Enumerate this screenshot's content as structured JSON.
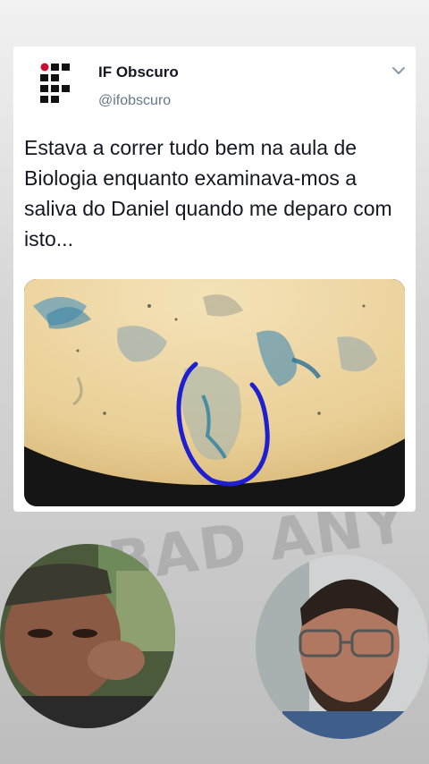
{
  "tweet": {
    "display_name": "IF Obscuro",
    "handle": "@ifobscuro",
    "text": "Estava a correr tudo bem na aula de Biologia enquanto examinava-mos a saliva do Daniel quando me deparo com isto...",
    "media": {
      "description_icon": "microscope-image"
    }
  },
  "background": {
    "graffiti_text": "BAD ANY"
  },
  "icons": {
    "chevron": "chevron-down-icon",
    "logo": "if-logo-icon"
  },
  "colors": {
    "accent_circle": "#1d1fd0",
    "card": "#ffffff",
    "text": "#141823",
    "muted": "#657786"
  }
}
